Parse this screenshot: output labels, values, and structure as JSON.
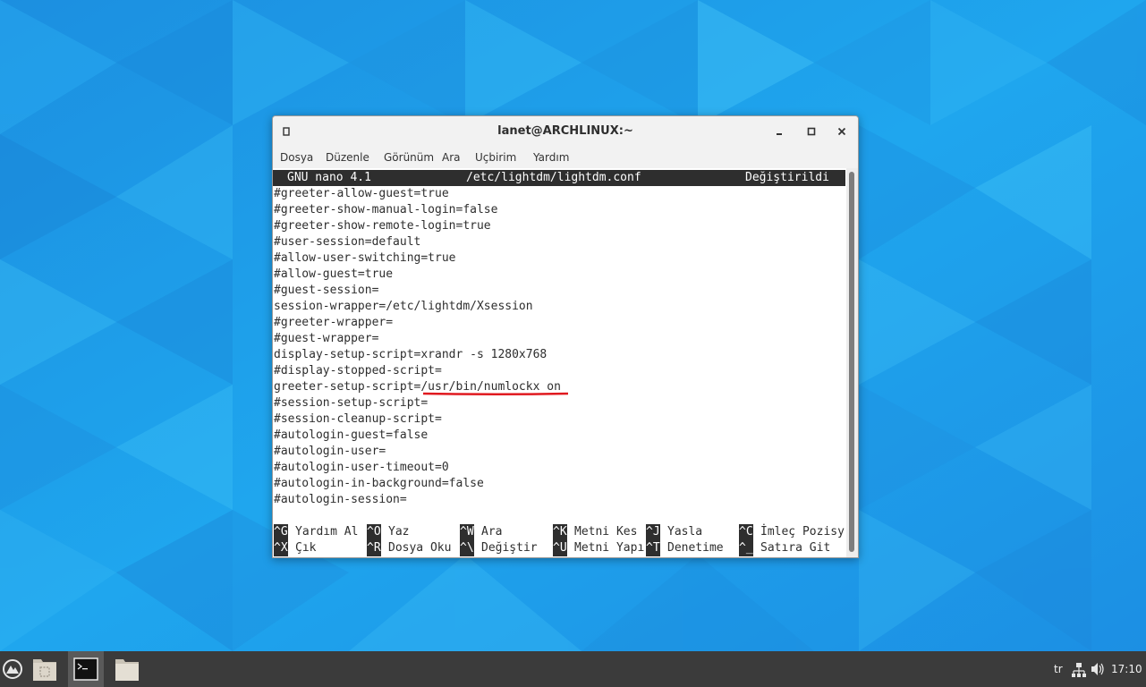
{
  "window": {
    "title": "lanet@ARCHLINUX:~",
    "menu": [
      "Dosya",
      "Düzenle",
      "Görünüm",
      "Ara",
      "Uçbirim",
      "Yardım"
    ]
  },
  "nano": {
    "version": "GNU nano 4.1",
    "filename": "/etc/lightdm/lightdm.conf",
    "status": "Değiştirildi",
    "lines": [
      "#greeter-allow-guest=true",
      "#greeter-show-manual-login=false",
      "#greeter-show-remote-login=true",
      "#user-session=default",
      "#allow-user-switching=true",
      "#allow-guest=true",
      "#guest-session=",
      "session-wrapper=/etc/lightdm/Xsession",
      "#greeter-wrapper=",
      "#guest-wrapper=",
      "display-setup-script=xrandr -s 1280x768",
      "#display-stopped-script=",
      "greeter-setup-script=/usr/bin/numlockx on",
      "#session-setup-script=",
      "#session-cleanup-script=",
      "#autologin-guest=false",
      "#autologin-user=",
      "#autologin-user-timeout=0",
      "#autologin-in-background=false",
      "#autologin-session="
    ],
    "shortcuts_row1": [
      {
        "key": "^G",
        "label": "Yardım Al"
      },
      {
        "key": "^O",
        "label": "Yaz"
      },
      {
        "key": "^W",
        "label": "Ara"
      },
      {
        "key": "^K",
        "label": "Metni Kes"
      },
      {
        "key": "^J",
        "label": "Yasla"
      },
      {
        "key": "^C",
        "label": "İmleç Pozisy"
      }
    ],
    "shortcuts_row2": [
      {
        "key": "^X",
        "label": "Çık"
      },
      {
        "key": "^R",
        "label": "Dosya Oku"
      },
      {
        "key": "^\\",
        "label": "Değiştir"
      },
      {
        "key": "^U",
        "label": "Metni Yapı"
      },
      {
        "key": "^T",
        "label": "Denetime"
      },
      {
        "key": "^_",
        "label": "Satıra Git"
      }
    ]
  },
  "taskbar": {
    "keyboard_layout": "tr",
    "clock": "17:10",
    "apps": [
      "start-menu-icon",
      "file-manager-icon",
      "terminal-icon",
      "folder-icon"
    ]
  },
  "colors": {
    "annotation_underline": "#e0191f",
    "nano_bar": "#2e2e2e",
    "taskbar": "#3b3b3b"
  }
}
